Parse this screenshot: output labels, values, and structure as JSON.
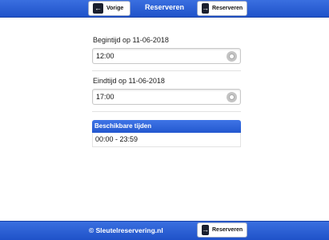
{
  "header": {
    "title": "Reserveren",
    "back_label": "Vorige",
    "reserve_label": "Reserveren"
  },
  "form": {
    "start_label": "Begintijd op 11-06-2018",
    "start_value": "12:00",
    "end_label": "Eindtijd op 11-06-2018",
    "end_value": "17:00"
  },
  "available": {
    "header": "Beschikbare tijden",
    "slots": [
      "00:00 - 23:59"
    ]
  },
  "footer": {
    "copyright": "© Sleutelreservering.nl",
    "reserve_label": "Reserveren"
  },
  "icons": {
    "back": "arrow-left-icon",
    "forward": "arrow-right-icon",
    "clear": "clear-icon"
  },
  "colors": {
    "bar": "#2a5ed6",
    "accent": "#2358cf"
  }
}
